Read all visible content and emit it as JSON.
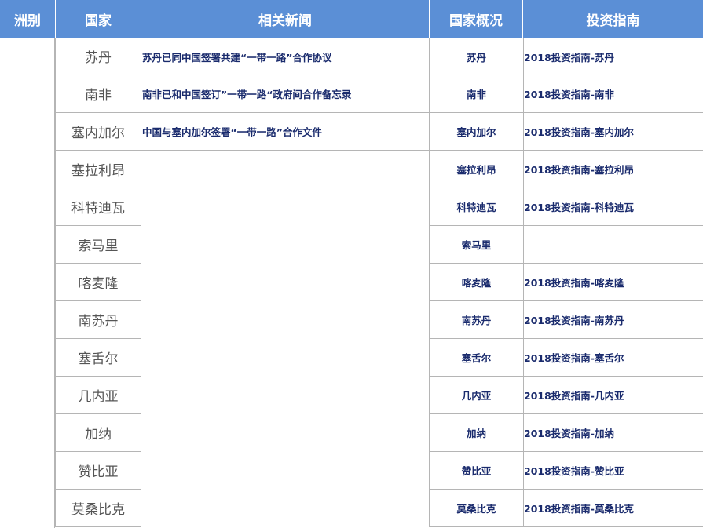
{
  "header": {
    "continent": "洲别",
    "country": "国家",
    "news": "相关新闻",
    "profile": "国家概况",
    "guide": "投资指南"
  },
  "rows": [
    {
      "country": "苏丹",
      "news": "苏丹已同中国签署共建“一带一路”合作协议",
      "profile": "苏丹",
      "guide": "2018投资指南-苏丹"
    },
    {
      "country": "南非",
      "news": "南非已和中国签订”一带一路“政府间合作备忘录",
      "profile": "南非",
      "guide": "2018投资指南-南非"
    },
    {
      "country": "塞内加尔",
      "news": "中国与塞内加尔签署“一带一路”合作文件",
      "profile": "塞内加尔",
      "guide": "2018投资指南-塞内加尔"
    },
    {
      "country": "塞拉利昂",
      "news": "",
      "profile": "塞拉利昂",
      "guide": "2018投资指南-塞拉利昂"
    },
    {
      "country": "科特迪瓦",
      "news": "",
      "profile": "科特迪瓦",
      "guide": "2018投资指南-科特迪瓦"
    },
    {
      "country": "索马里",
      "news": "",
      "profile": "索马里",
      "guide": ""
    },
    {
      "country": "喀麦隆",
      "news": "",
      "profile": "喀麦隆",
      "guide": "2018投资指南-喀麦隆"
    },
    {
      "country": "南苏丹",
      "news": "",
      "profile": "南苏丹",
      "guide": "2018投资指南-南苏丹"
    },
    {
      "country": "塞舌尔",
      "news": "",
      "profile": "塞舌尔",
      "guide": "2018投资指南-塞舌尔"
    },
    {
      "country": "几内亚",
      "news": "",
      "profile": "几内亚",
      "guide": "2018投资指南-几内亚"
    },
    {
      "country": "加纳",
      "news": "",
      "profile": "加纳",
      "guide": "2018投资指南-加纳"
    },
    {
      "country": "赞比亚",
      "news": "",
      "profile": "赞比亚",
      "guide": "2018投资指南-赞比亚"
    },
    {
      "country": "莫桑比克",
      "news": "",
      "profile": "莫桑比克",
      "guide": "2018投资指南-莫桑比克"
    }
  ]
}
